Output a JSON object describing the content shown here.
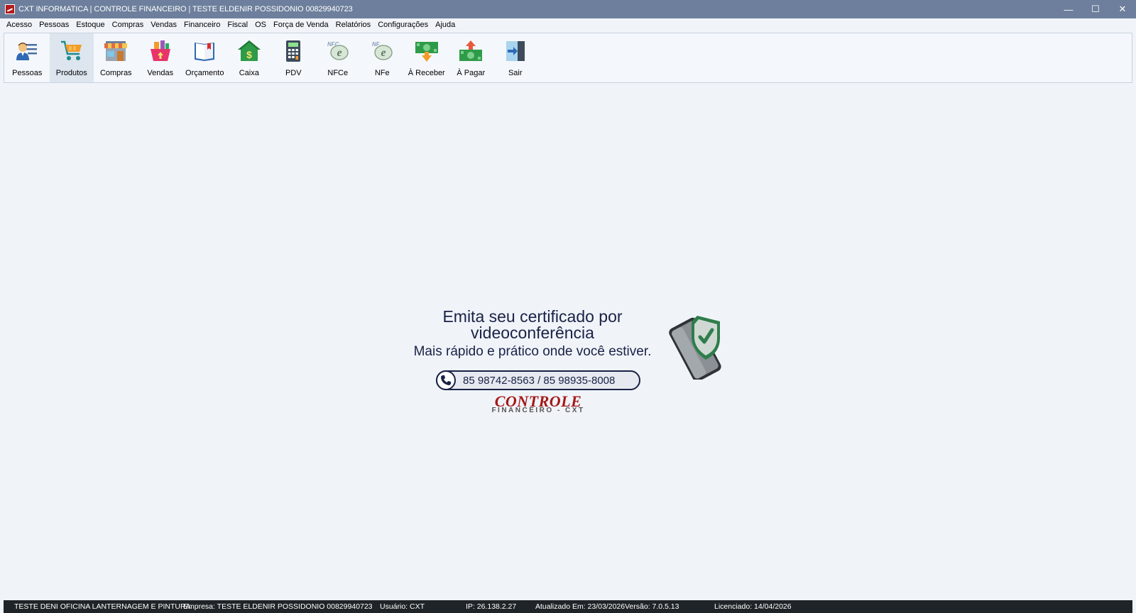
{
  "window": {
    "title": "CXT INFORMATICA | CONTROLE FINANCEIRO | TESTE ELDENIR POSSIDONIO 00829940723",
    "minimize_glyph": "—",
    "maximize_glyph": "☐",
    "close_glyph": "✕"
  },
  "menu": {
    "items": [
      "Acesso",
      "Pessoas",
      "Estoque",
      "Compras",
      "Vendas",
      "Financeiro",
      "Fiscal",
      "OS",
      "Força de Venda",
      "Relatórios",
      "Configurações",
      "Ajuda"
    ]
  },
  "toolbar": {
    "buttons": [
      {
        "label": "Pessoas",
        "icon": "people-icon"
      },
      {
        "label": "Produtos",
        "icon": "cart-icon",
        "active": true
      },
      {
        "label": "Compras",
        "icon": "store-icon"
      },
      {
        "label": "Vendas",
        "icon": "basket-icon"
      },
      {
        "label": "Orçamento",
        "icon": "book-icon"
      },
      {
        "label": "Caixa",
        "icon": "house-dollar-icon"
      },
      {
        "label": "PDV",
        "icon": "calculator-icon"
      },
      {
        "label": "NFCe",
        "icon": "nfce-icon"
      },
      {
        "label": "NFe",
        "icon": "nfe-icon"
      },
      {
        "label": "À Receber",
        "icon": "receive-money-icon"
      },
      {
        "label": "À Pagar",
        "icon": "pay-money-icon"
      },
      {
        "label": "Sair",
        "icon": "exit-icon"
      }
    ]
  },
  "banner": {
    "line1": "Emita seu certificado por",
    "line2": "videoconferência",
    "line3": "Mais rápido e prático onde você estiver.",
    "phones": "85 98742-8563 / 85 98935-8008",
    "brand_main": "CONTROLE",
    "brand_sub": "FINANCEIRO - CXT"
  },
  "status": {
    "company_name": "TESTE DENI OFICINA LANTERNAGEM E PINTURA",
    "empresa": "Empresa: TESTE ELDENIR POSSIDONIO 00829940723",
    "usuario": "Usuário: CXT",
    "ip": "IP: 26.138.2.27",
    "atualizado": "Atualizado Em: 23/03/2026",
    "versao": "Versão: 7.0.5.13",
    "licenciado": "Licenciado: 14/04/2026"
  },
  "colors": {
    "titlebar": "#6d7f9c",
    "background": "#f0f4f9",
    "statusbar": "#1f2428",
    "banner_text": "#1a2145",
    "brand_red": "#a51818"
  }
}
